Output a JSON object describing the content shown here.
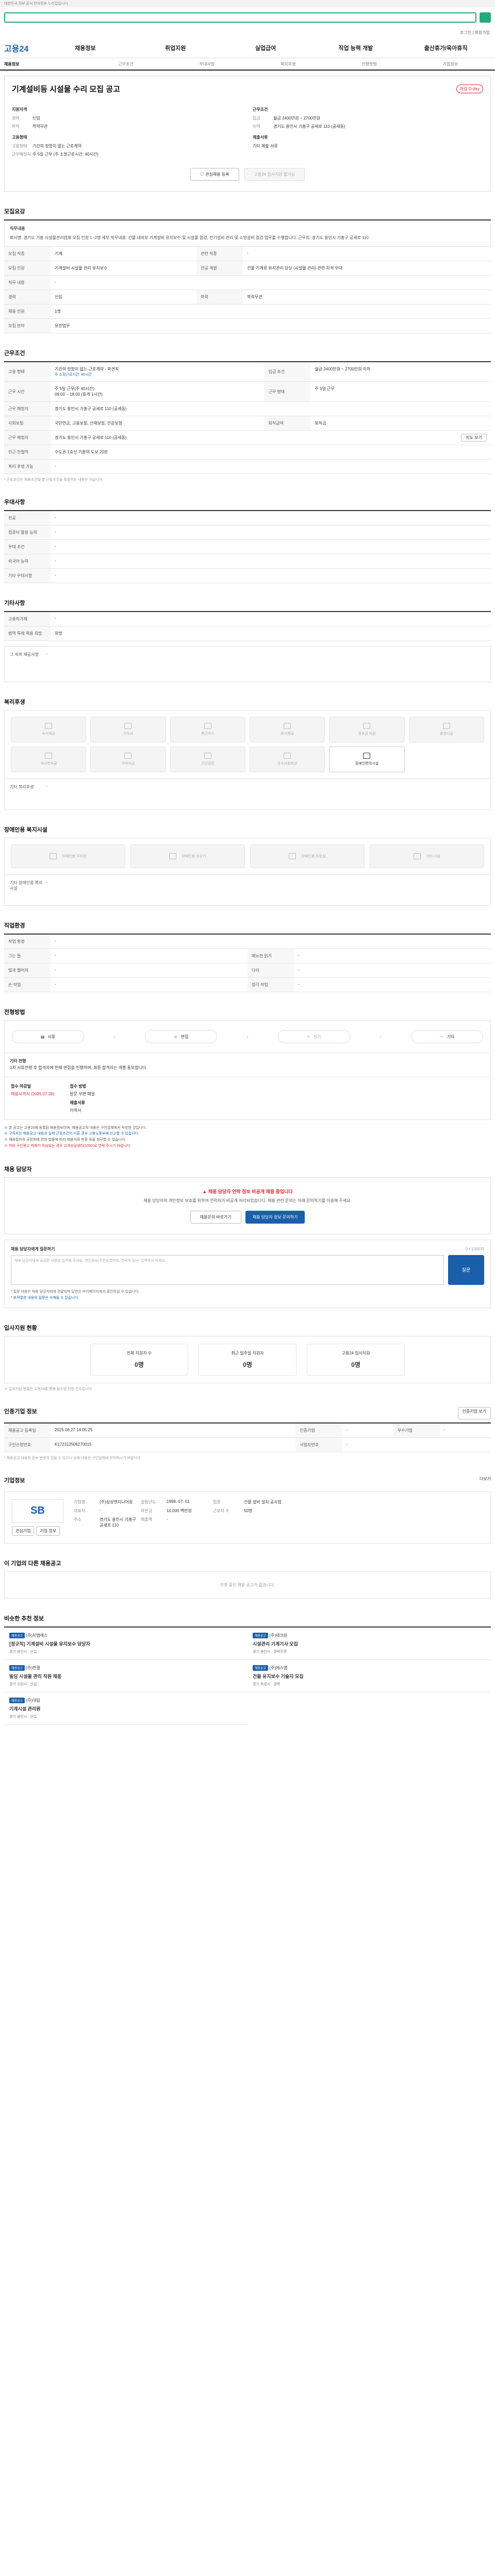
{
  "topbar": {
    "text": "대한민국 정부 공식 전자정부 누리집입니다."
  },
  "util": {
    "text": "로그인 | 회원가입"
  },
  "gnb": {
    "logo": "고용24",
    "items": [
      "채용정보",
      "취업지원",
      "실업급여",
      "직업 능력 개발",
      "출산휴가/육아휴직"
    ]
  },
  "subnav": [
    "채용정보",
    "근무조건",
    "우대사항",
    "복리후생",
    "전형방법",
    "기업정보"
  ],
  "job": {
    "title": "기계설비등 시설물 수리 모집 공고",
    "badge": "마감 D-day",
    "left_heading": "지원자격",
    "left": [
      {
        "k": "경력",
        "v": "신입"
      },
      {
        "k": "학력",
        "v": "학력무관"
      }
    ],
    "left_heading2": "고용형태",
    "left2": [
      {
        "k": "고용형태",
        "v": "기간의 정함이 없는 근로계약"
      },
      {
        "k": "근무예정지",
        "v": "주 5일 근무 (주 소정근로시간: 40시간)"
      }
    ],
    "right_heading": "근무조건",
    "right": [
      {
        "k": "임금",
        "v": "월급 2400만원 ~ 2700만원"
      },
      {
        "k": "지역",
        "v": "경기도 용인시 기흥구 공세로 110 (공세동)"
      }
    ],
    "right_heading2": "제출서류",
    "right2": [
      {
        "k": "",
        "v": "기타 제출 서류"
      }
    ],
    "btn_interest": "관심채용 등록",
    "btn_apply": "고용24 입사지원 불가능"
  },
  "recruit": {
    "title": "모집요강",
    "memo_label": "직무내용",
    "memo": "회사명: 경기도 기흥 시설물관리업체 모집 인원 1~2명 세부 직무내용: 건물 내외부 기계설비 유지보수 및 시설물 점검, 전기설비 관리 및 소방설비 점검 업무를 수행합니다. 근무지: 경기도 용인시 기흥구 공세로 110",
    "rows": [
      {
        "k": "모집 직종",
        "v": "기계",
        "k2": "관련 직종",
        "v2": "-"
      },
      {
        "k": "모집 인원",
        "v": "기계설비 시설물 관리 유지보수",
        "k2": "전공 계열",
        "v2": "건물 기계류 유지관리 담당 (시설물 관리) 관련 자격 우대"
      },
      {
        "k": "직무 내용",
        "v": "-",
        "k2": "",
        "v2": ""
      },
      {
        "k": "경력",
        "v": "신입",
        "k2": "학력",
        "v2": "학력무관"
      },
      {
        "k": "채용 인원",
        "v": "1명",
        "k2": "",
        "v2": ""
      },
      {
        "k": "모집 분야",
        "v": "유관업무",
        "k2": "",
        "v2": ""
      }
    ]
  },
  "conditions": {
    "title": "근무조건",
    "rows": [
      {
        "k": "고용 형태",
        "v": "기간의 정함이 없는 근로계약 · 파견직",
        "k2": "임금 조건",
        "v2": "월급 2400만원 ~ 2700만원 이하"
      },
      {
        "k": "",
        "v": "주 소정근로시간: 40시간",
        "k2": "",
        "v2": ""
      },
      {
        "k": "근무 시간",
        "v": "주 5일 근무(주 40시간)",
        "k2": "근무 형태",
        "v2": "주 5일 근무"
      },
      {
        "k": "",
        "v": "09:00 ~ 18:00 (휴게 1시간)",
        "k2": "",
        "v2": ""
      },
      {
        "k": "근무 예정지",
        "v": "경기도 용인시 기흥구 공세로 110 (공세동)",
        "k2": "",
        "v2": ""
      },
      {
        "k": "사회보험",
        "v": "국민연금, 고용보험, 산재보험, 건강보험",
        "k2": "퇴직급여",
        "v2": "퇴직금"
      },
      {
        "k": "근무 예정지",
        "v": "경기도 용인시 기흥구 공세로 110 (공세동)",
        "k2": "",
        "v2": ""
      },
      {
        "k": "인근 전철역",
        "v": "수도권 1호선 기흥역 도보 20분",
        "k2": "",
        "v2": ""
      },
      {
        "k": "복리 후생 가능",
        "v": "-",
        "k2": "",
        "v2": ""
      }
    ],
    "map_btn": "지도 보기",
    "note": "* 근로조건은 채용조건일 뿐 근로조건을 확정하는 내용은 아닙니다."
  },
  "preference": {
    "title": "우대사항",
    "rows": [
      {
        "k": "전공",
        "v": "-"
      },
      {
        "k": "컴퓨터 활용 능력",
        "v": "-"
      },
      {
        "k": "우대 조건",
        "v": "-"
      },
      {
        "k": "외국어 능력",
        "v": "-"
      },
      {
        "k": "기타 우대사항",
        "v": "-"
      }
    ]
  },
  "etc": {
    "title": "기타사항",
    "rows": [
      {
        "k": "고용허가제",
        "v": "-"
      },
      {
        "k": "병역 특례 채용 희망",
        "v": "희망"
      }
    ],
    "extra_label": "그 외의 제공사항",
    "extra": "-"
  },
  "welfare": {
    "title": "복리후생",
    "items": [
      "숙식제공",
      "기숙사",
      "통근버스",
      "중식제공",
      "경조금 지원",
      "휴양시설",
      "자녀학자금",
      "주택자금",
      "건강검진",
      "우수사원포상",
      "장애인편의시설"
    ],
    "extra_label": "기타 복리후생",
    "extra": "-"
  },
  "disabled": {
    "title": "장애인용 복지시설",
    "items": [
      "장애인용 주차장",
      "장애인용 승강기",
      "장애인용 화장실",
      "기타 시설"
    ],
    "extra_label": "기타 장애인용 복지시설",
    "extra": "-"
  },
  "jobcond": {
    "title": "직업환경",
    "rows": [
      {
        "k": "작업 환경",
        "v": "-",
        "k2": "",
        "v2": ""
      },
      {
        "k": "그는 들",
        "v": "-",
        "k2": "메뉴판 읽기",
        "v2": "-"
      },
      {
        "k": "빛과 떨어지",
        "v": "-",
        "k2": "다리",
        "v2": "-"
      },
      {
        "k": "손 작업",
        "v": "-",
        "k2": "청각 작업",
        "v2": "-"
      }
    ]
  },
  "process": {
    "title": "전형방법",
    "steps": [
      "서류",
      "면접",
      "필기",
      "기타"
    ],
    "note_label": "기타 전형",
    "note": "1차 서류전형 후 합격자에 한해 면접을 진행하며, 최종 합격자는 개별 통보합니다.",
    "apply_k1": "접수 마감일",
    "apply_v1": "채용시까지 (2025.07.28)",
    "apply_k2": "접수 방법",
    "apply_v2": "방문 우편 메일",
    "apply_k3": "제출서류",
    "apply_v3": "이력서",
    "bullets": [
      "※ 본 공고는 고용24에 등록된 채용정보이며, 채용공고의 내용은 구인업체에서 작성한 것입니다.",
      "※ 구직자는 채용공고 내용과 실제 근로조건이 다른 경우 고용노동부에 신고할 수 있습니다.",
      "※ 채용절차의 공정화에 관한 법률에 따라 채용서류 반환 등을 청구할 수 있습니다.",
      "※ 허위 구인광고 피해가 의심되는 경우 고객상담센터(1350)로 연락 주시기 바랍니다."
    ]
  },
  "contact": {
    "title": "채용 담당자",
    "warn": "채용 담당자 연락 정보 비공개 채용 중입니다",
    "desc": "채용 담당자의 개인정보 보호를 위하여 연락처가 비공개 처리되었습니다. 채용 관련 문의는 아래 문의하기를 이용해 주세요.",
    "btn1": "채용문의 바로가기",
    "btn2": "채용 담당자 정보 문의하기"
  },
  "question": {
    "label": "채용 담당자에게 질문하기",
    "count": "0 / 1000자",
    "placeholder": "채용 담당자에게 궁금한 사항을 입력해 주세요. 개인정보(주민등록번호, 연락처 등)는 입력하지 마세요.",
    "submit": "질문",
    "notes": [
      "* 질문 내용은 채용 담당자에게 전달되며 답변은 마이페이지에서 확인하실 수 있습니다.",
      "* 부적절한 내용의 질문은 삭제될 수 있습니다."
    ]
  },
  "applicants": {
    "title": "입사지원 현황",
    "cards": [
      {
        "label": "전체 지원자 수",
        "value": "0명"
      },
      {
        "label": "최근 일주일 지원자",
        "value": "0명"
      },
      {
        "label": "고용24 입사지원",
        "value": "0명"
      }
    ],
    "note": "※ 입사지원 현황은 고용24를 통해 접수된 지원 건수입니다."
  },
  "reginfo": {
    "title": "인증기업 정보",
    "btn": "인증기업 보기",
    "rows": [
      {
        "k": "채용공고 등록일",
        "v": "2025.06.27 14:05:25",
        "k2": "인증기업",
        "v2": "-",
        "k3": "우수기업",
        "v3": "-"
      },
      {
        "k": "구인신청번호",
        "v": "K172112506270015",
        "k2": "사업자번호",
        "v2": "-",
        "k3": "",
        "v3": ""
      }
    ],
    "note": "* 채용공고 내용의 정보 변경이 있을 수 있으니 상세 내용은 구인업체에 문의하시기 바랍니다."
  },
  "company": {
    "title": "기업정보",
    "more": "더보기",
    "logo": "SB",
    "rows": [
      {
        "k": "기업명",
        "v": "(주)삼성엔지니어링",
        "k2": "설립년도",
        "v2": "1998. 07. 01",
        "k3": "업종",
        "v3": "건물 설비 설치 공사업"
      },
      {
        "k": "대표자",
        "v": "-",
        "k2": "자본금",
        "v2": "10,000 백만원",
        "k3": "근로자 수",
        "v3": "50명"
      },
      {
        "k": "주소",
        "v": "경기도 용인시 기흥구 공세로 110",
        "k2": "매출액",
        "v2": "-",
        "k3": "",
        "v3": ""
      }
    ],
    "btn_interest": "관심기업",
    "btn_view": "기업 정보"
  },
  "otherjobs": {
    "title": "이 기업의 다른 채용공고",
    "empty": "진행 중인 채용 공고가 없습니다."
  },
  "recommend": {
    "title": "비슷한 추천 정보",
    "items": [
      {
        "label": "채용공고",
        "company": "(주)지엠에스",
        "title": "[정규직] 기계설비 시설물 유지보수 담당자",
        "meta": "경기 용인시 · 신입"
      },
      {
        "label": "채용공고",
        "company": "(주)테크원",
        "title": "시설관리 기계기사 모집",
        "meta": "경기 용인시 · 경력무관"
      },
      {
        "label": "채용공고",
        "company": "(주)한결",
        "title": "빌딩 시설물 관리 직원 채용",
        "meta": "경기 수원시 · 신입"
      },
      {
        "label": "채용공고",
        "company": "(주)에스엠",
        "title": "건물 유지보수 기술자 모집",
        "meta": "경기 화성시 · 경력"
      },
      {
        "label": "채용공고",
        "company": "(주)대림",
        "title": "기계시설 관리원",
        "meta": "경기 용인시 · 신입"
      }
    ]
  }
}
